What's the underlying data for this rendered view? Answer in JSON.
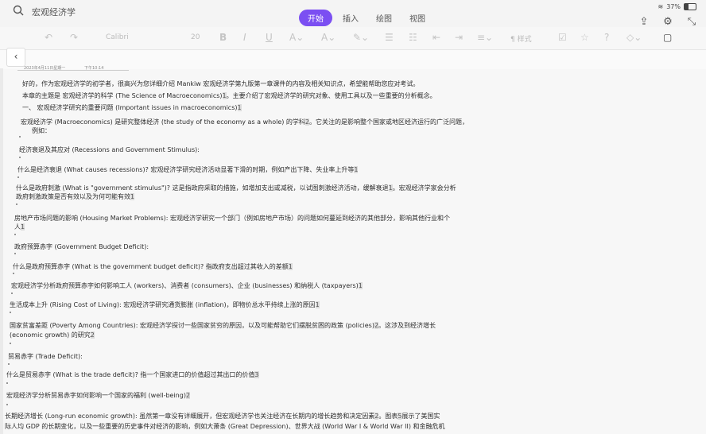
{
  "app": {
    "title": "宏观经济学",
    "tabs": [
      {
        "label": "开始",
        "active": true
      },
      {
        "label": "插入",
        "active": false
      },
      {
        "label": "绘图",
        "active": false
      },
      {
        "label": "视图",
        "active": false
      }
    ],
    "battery": "37%",
    "accent": "#7b4ff2"
  },
  "toolbar": {
    "font_name": "Calibri",
    "font_size": "20",
    "styles_label": "样式"
  },
  "page": {
    "date": "2023年4月11日星期一",
    "time": "下午10:14"
  },
  "lines": [
    "好的，作为宏观经济学的初学者，很高兴为您详细介绍 Mankiw 宏观经济学第九版第一章课件的内容及相关知识点，希望能帮助您应对考试。",
    "本章的主题是 宏观经济学的科学 (The Science of Macroeconomics)",
    "。主要介绍了宏观经济学的研究对象、使用工具以及一些重要的分析概念。",
    "一、 宏观经济学研究的重要问题 (Important issues in macroeconomics)",
    "宏观经济学 (Macroeconomics) 是研究整体经济 (the study of the economy as a whole) 的学科",
    "。它关注的是影响整个国家或地区经济运行的广泛问题，",
    "例如：",
    "经济衰退及其应对 (Recessions and Government Stimulus):",
    "什么是经济衰退 (What causes recessions)? 宏观经济学研究经济活动显著下滑的时期，例如产出下降、失业率上升等",
    "什么是政府刺激 (What is \"government stimulus\")? 这是指政府采取的措施，如增加支出或减税，以试图刺激经济活动，缓解衰退",
    "。宏观经济学家会分析",
    "政府刺激政策是否有效以及为何可能有效",
    "房地产市场问题的影响 (Housing Market Problems): 宏观经济学研究一个部门（例如房地产市场）的问题如何蔓延到经济的其他部分，影响其他行业和个",
    "人",
    "政府预算赤字 (Government Budget Deficit):",
    "什么是政府预算赤字 (What is the government budget deficit)? 指政府支出超过其收入的差额",
    "宏观经济学分析政府预算赤字如何影响工人 (workers)、消费者 (consumers)、企业 (businesses) 和纳税人 (taxpayers)",
    "生活成本上升 (Rising Cost of Living): 宏观经济学研究通货膨胀 (inflation)，即物价总水平持续上涨的原因",
    "国家贫富差距 (Poverty Among Countries): 宏观经济学探讨一些国家贫穷的原因，以及可能帮助它们摆脱贫困的政策 (policies)",
    "。这涉及到经济增长",
    "(economic growth) 的研究",
    "贸易赤字 (Trade Deficit):",
    "什么是贸易赤字 (What is the trade deficit)? 指一个国家进口的价值超过其出口的价值",
    "宏观经济学分析贸易赤字如何影响一个国家的福利 (well-being)",
    "长期经济增长 (Long-run economic growth): 虽然第一章没有详细展开，但宏观经济学也关注经济在长期内的增长趋势和决定因素",
    "。图表",
    "展示了美国实",
    "际人均 GDP 的长期变化，以及一些重要的历史事件对经济的影响，例如大萧条 (Great Depression)、世界大战 (World War I & World War II) 和金融危机"
  ],
  "refs": [
    "1",
    "1",
    "2",
    "1",
    "1",
    "1",
    "1",
    "1",
    "1",
    "1",
    "2",
    "2",
    "3",
    "2",
    "2",
    "3",
    "5"
  ]
}
